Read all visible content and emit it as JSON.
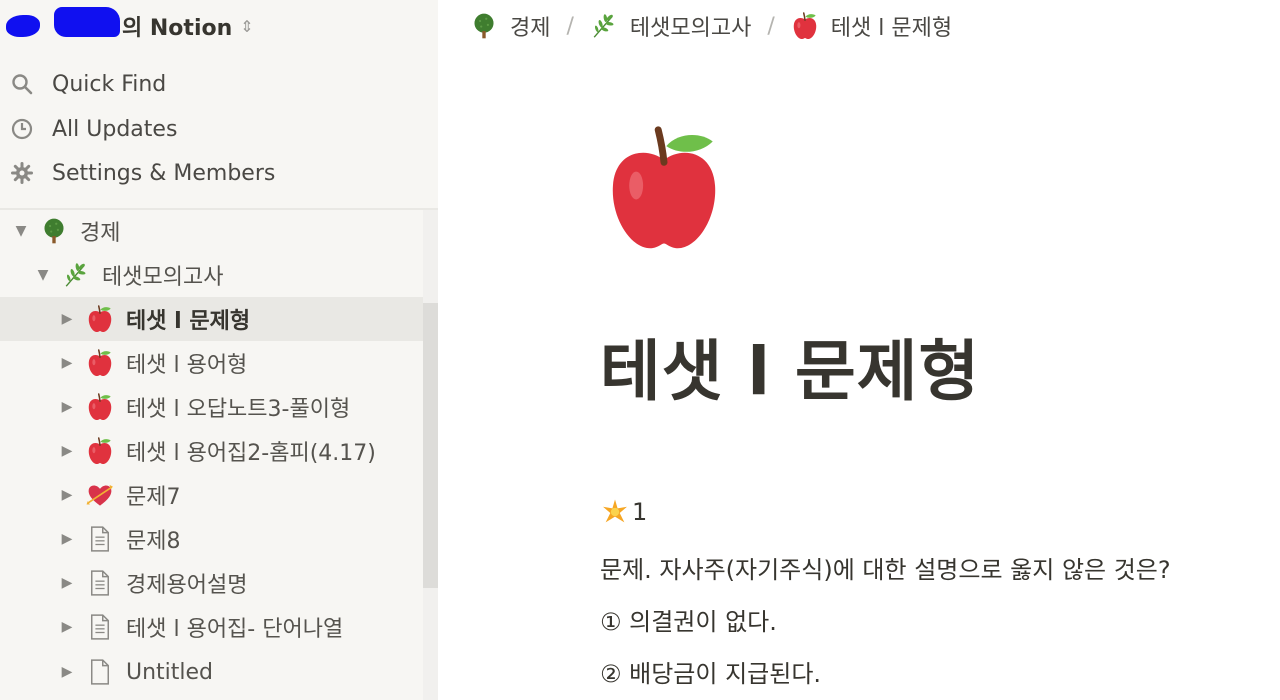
{
  "sidebar": {
    "workspace_name": "의 Notion",
    "workspace_chevron": "⌃",
    "nav": [
      {
        "label": "Quick Find",
        "icon": "search-icon"
      },
      {
        "label": "All Updates",
        "icon": "clock-icon"
      },
      {
        "label": "Settings & Members",
        "icon": "gear-icon"
      }
    ],
    "tree": [
      {
        "label": "경제",
        "icon": "tree-emoji",
        "expanded": true
      },
      {
        "label": "테샛모의고사",
        "icon": "herb-emoji",
        "expanded": true
      },
      {
        "label": "테샛 l 문제형",
        "icon": "apple-emoji",
        "selected": true
      },
      {
        "label": "테샛 l 용어형",
        "icon": "apple-emoji"
      },
      {
        "label": "테샛 l 오답노트3-풀이형",
        "icon": "apple-emoji"
      },
      {
        "label": "테샛 l 용어집2-홈피(4.17)",
        "icon": "apple-emoji"
      },
      {
        "label": "문제7",
        "icon": "heart-arrow-emoji"
      },
      {
        "label": "문제8",
        "icon": "page-icon"
      },
      {
        "label": "경제용어설명",
        "icon": "page-icon"
      },
      {
        "label": "테샛 l 용어집- 단어나열",
        "icon": "page-icon"
      },
      {
        "label": "Untitled",
        "icon": "blank-page-icon"
      }
    ]
  },
  "breadcrumb": [
    {
      "label": "경제",
      "icon": "tree-emoji"
    },
    {
      "label": "테샛모의고사",
      "icon": "herb-emoji"
    },
    {
      "label": "테샛 l 문제형",
      "icon": "apple-emoji"
    }
  ],
  "breadcrumb_separator": "/",
  "page": {
    "icon": "apple-emoji",
    "title": "테샛 l 문제형",
    "question_number": "1",
    "question_icon": "star-emoji",
    "question": "문제. 자사주(자기주식)에 대한 설명으로 옳지 않은 것은?",
    "options": [
      "① 의결권이 없다.",
      "② 배당금이 지급된다."
    ]
  },
  "colors": {
    "sidebar_bg": "#f7f6f3",
    "selected_bg": "#e9e8e4",
    "text": "#37352f",
    "apple_red": "#e0323e"
  }
}
